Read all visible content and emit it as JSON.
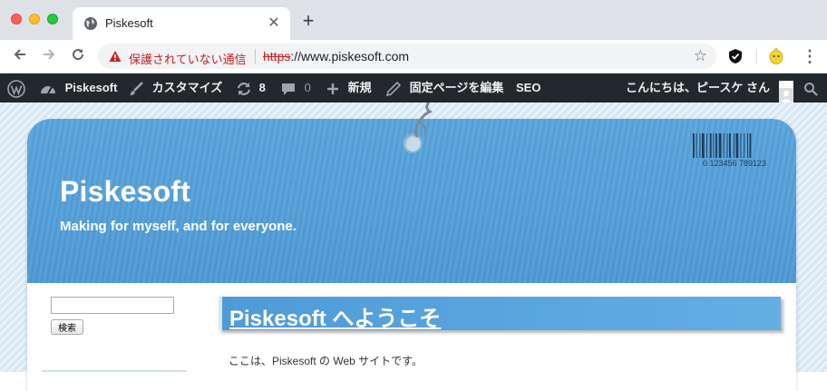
{
  "browser": {
    "tab_title": "Piskesoft",
    "security_text": "保護されていない通信",
    "url_scheme": "https",
    "url_rest": "://www.piskesoft.com"
  },
  "admin_bar": {
    "site_name": "Piskesoft",
    "customize": "カスタマイズ",
    "updates_count": "8",
    "comments_count": "0",
    "new": "新規",
    "edit_page": "固定ページを編集",
    "seo": "SEO",
    "greeting": "こんにちは、ピースケ さん"
  },
  "header": {
    "title": "Piskesoft",
    "tagline": "Making for myself, and for everyone.",
    "barcode_text": "0 123456 789123"
  },
  "sidebar": {
    "search_button": "検索"
  },
  "post": {
    "title": "Piskesoft へようこそ",
    "body": "ここは、Piskesoft の Web サイトです。"
  },
  "colors": {
    "adminbar_bg": "#23282d",
    "banner_blue": "#5aa5dd",
    "warning_red": "#c5221f"
  }
}
